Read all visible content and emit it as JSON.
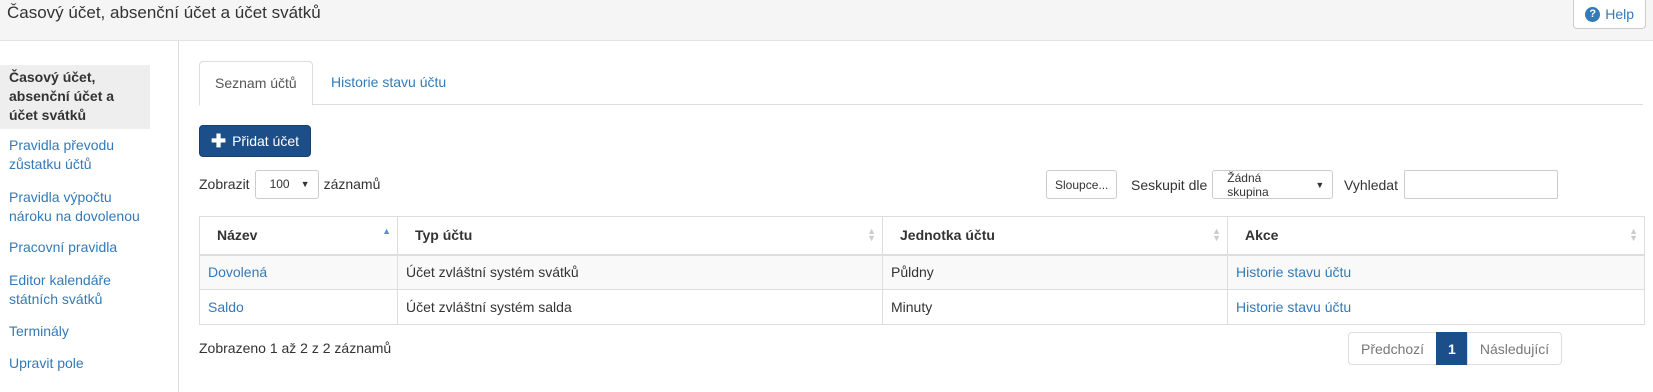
{
  "header": {
    "title": "Časový účet, absenční účet a účet svátků",
    "help_label": "Help"
  },
  "sidebar": {
    "items": [
      {
        "label": "Časový účet, absenční účet a účet svátků",
        "active": true
      },
      {
        "label": "Pravidla převodu zůstatku účtů"
      },
      {
        "label": "Pravidla výpočtu nároku na dovolenou"
      },
      {
        "label": "Pracovní pravidla"
      },
      {
        "label": "Editor kalendáře státních svátků"
      },
      {
        "label": "Terminály"
      },
      {
        "label": "Upravit pole"
      }
    ]
  },
  "tabs": [
    {
      "label": "Seznam účtů",
      "active": true
    },
    {
      "label": "Historie stavu účtu"
    }
  ],
  "toolbar": {
    "add_label": "Přidat účet",
    "show_label": "Zobrazit",
    "page_size": "100",
    "records_label": "záznamů",
    "columns_label": "Sloupce...",
    "group_label": "Seskupit dle",
    "group_value": "Žádná skupina",
    "search_label": "Vyhledat",
    "search_value": ""
  },
  "table": {
    "columns": [
      "Název",
      "Typ účtu",
      "Jednotka účtu",
      "Akce"
    ],
    "rows": [
      {
        "name": "Dovolená",
        "type": "Účet zvláštní systém svátků",
        "unit": "Půldny",
        "action": "Historie stavu účtu"
      },
      {
        "name": "Saldo",
        "type": "Účet zvláštní systém salda",
        "unit": "Minuty",
        "action": "Historie stavu účtu"
      }
    ]
  },
  "footer": {
    "info": "Zobrazeno 1 až 2 z 2 záznamů",
    "prev_label": "Předchozí",
    "current_page": "1",
    "next_label": "Následující"
  },
  "colors": {
    "primary": "#1c4f8a",
    "link": "#337ab7"
  }
}
